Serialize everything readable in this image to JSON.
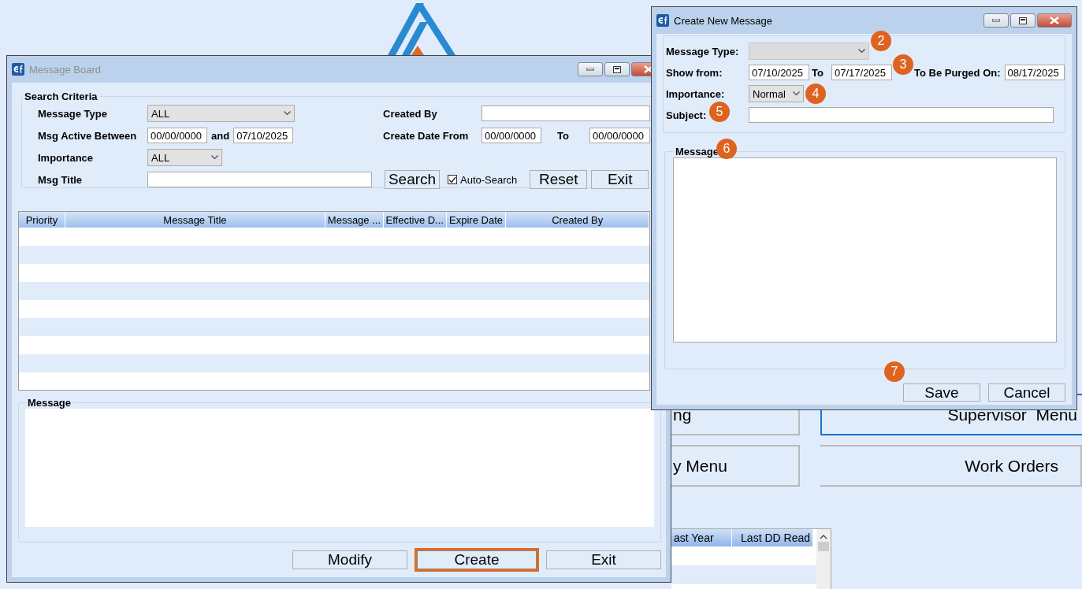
{
  "background": {
    "buttons": [
      {
        "label": "ng",
        "selected": false
      },
      {
        "label": "Supervisor  Menu",
        "selected": true
      },
      {
        "label": "y Menu",
        "selected": false
      },
      {
        "label": "Work Orders",
        "selected": false
      }
    ],
    "table": {
      "columns": [
        "ast Year",
        "Last DD Read"
      ]
    }
  },
  "message_board": {
    "title": "Message Board",
    "active": false,
    "search": {
      "legend": "Search Criteria",
      "message_type": {
        "label": "Message Type",
        "value": "ALL"
      },
      "active_between": {
        "label": "Msg Active Between",
        "from": "00/00/0000",
        "joiner": "and",
        "to": "07/10/2025"
      },
      "importance": {
        "label": "Importance",
        "value": "ALL"
      },
      "title": {
        "label": "Msg Title"
      },
      "created_by": {
        "label": "Created By"
      },
      "create_date": {
        "label": "Create Date From",
        "from": "00/00/0000",
        "joiner": "To",
        "to": "00/00/0000"
      },
      "search_button": "Search",
      "auto_search": {
        "label": "Auto-Search",
        "checked": true
      },
      "reset_button": "Reset",
      "exit_button": "Exit"
    },
    "table": {
      "columns": [
        "Priority",
        "Message Title",
        "Message ...",
        "Effective D...",
        "Expire Date",
        "Created By"
      ]
    },
    "message": {
      "legend": "Message"
    },
    "buttons": [
      {
        "label": "Modify",
        "highlighted": false
      },
      {
        "label": "Create",
        "highlighted": true
      },
      {
        "label": "Exit",
        "highlighted": false
      }
    ]
  },
  "dialog": {
    "title": "Create New Message",
    "active": true,
    "message_type": {
      "label": "Message Type:",
      "disabled": true
    },
    "show_from": {
      "label": "Show from:",
      "from": "07/10/2025",
      "joiner": "To",
      "to": "07/17/2025"
    },
    "purge": {
      "label": "To Be Purged On:",
      "value": "08/17/2025"
    },
    "importance": {
      "label": "Importance:",
      "value": "Normal"
    },
    "subject": {
      "label": "Subject:"
    },
    "message": {
      "legend": "Message"
    },
    "buttons": [
      "Save",
      "Cancel"
    ]
  },
  "badges": [
    "2",
    "3",
    "4",
    "5",
    "6",
    "7"
  ]
}
